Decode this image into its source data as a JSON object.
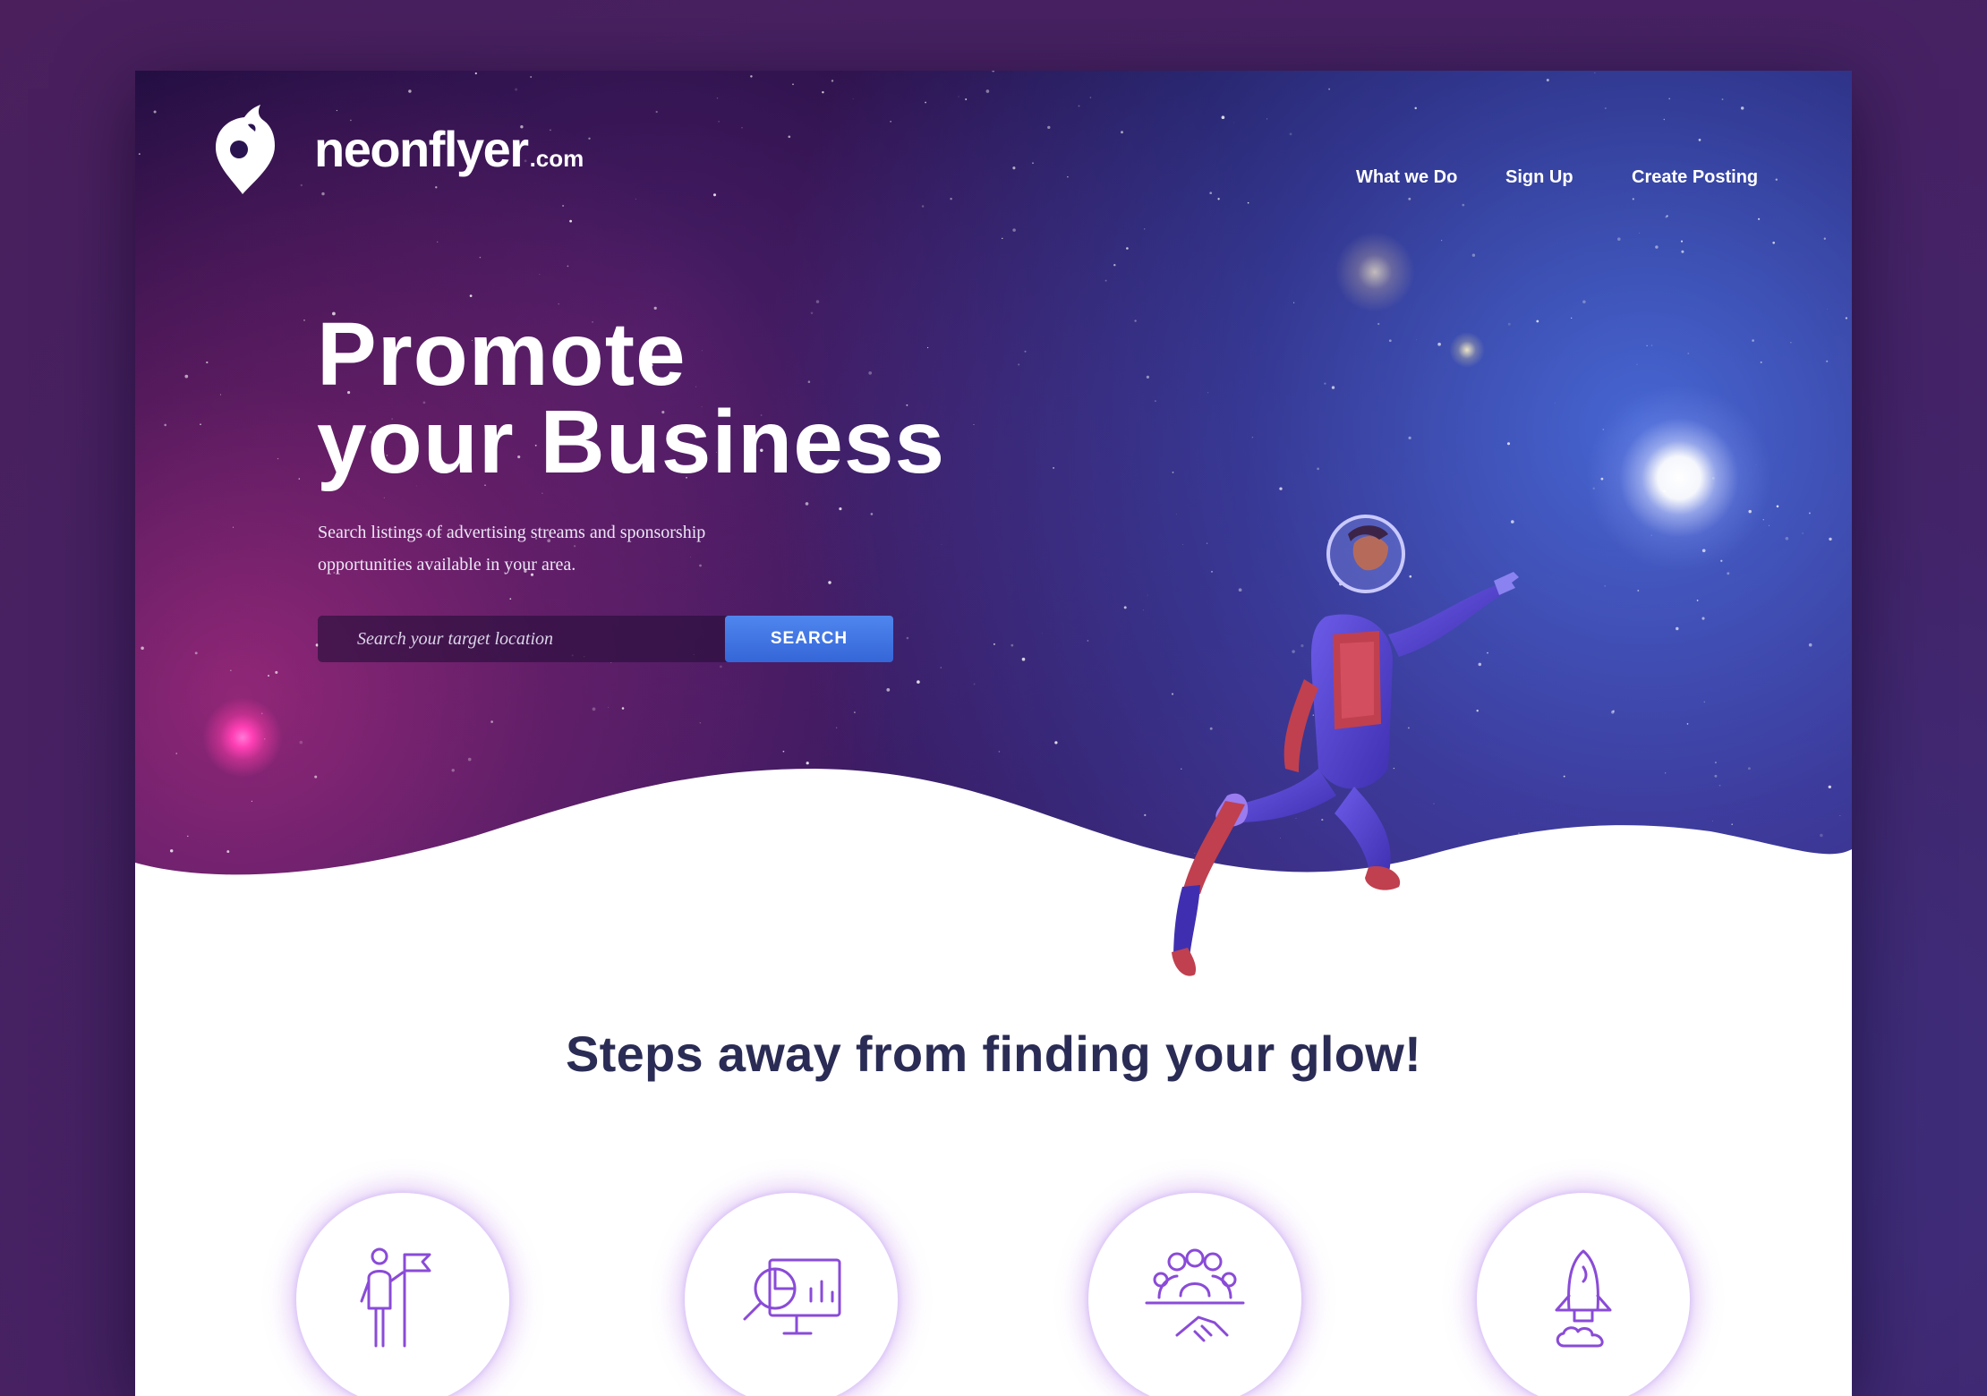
{
  "brand": {
    "name": "neonflyer",
    "suffix": ".com"
  },
  "nav": {
    "items": [
      {
        "label": "What we Do"
      },
      {
        "label": "Sign Up"
      },
      {
        "label": "Create Posting"
      }
    ]
  },
  "hero": {
    "title_line1": "Promote",
    "title_line2": "your Business",
    "subtitle_line1": "Search listings of advertising streams and sponsorship",
    "subtitle_line2": "opportunities available in your area.",
    "search": {
      "placeholder": "Search your target location",
      "button_label": "SEARCH"
    }
  },
  "steps_section": {
    "heading": "Steps away from finding your glow!",
    "steps": [
      {
        "icon": "person-with-flag-icon"
      },
      {
        "icon": "analytics-search-icon"
      },
      {
        "icon": "team-handshake-icon"
      },
      {
        "icon": "rocket-launch-icon"
      }
    ]
  },
  "colors": {
    "accent": "#3d6de0",
    "heading": "#2a2c55",
    "icon_purple": "#8a4bd8",
    "background": "#43246a"
  }
}
